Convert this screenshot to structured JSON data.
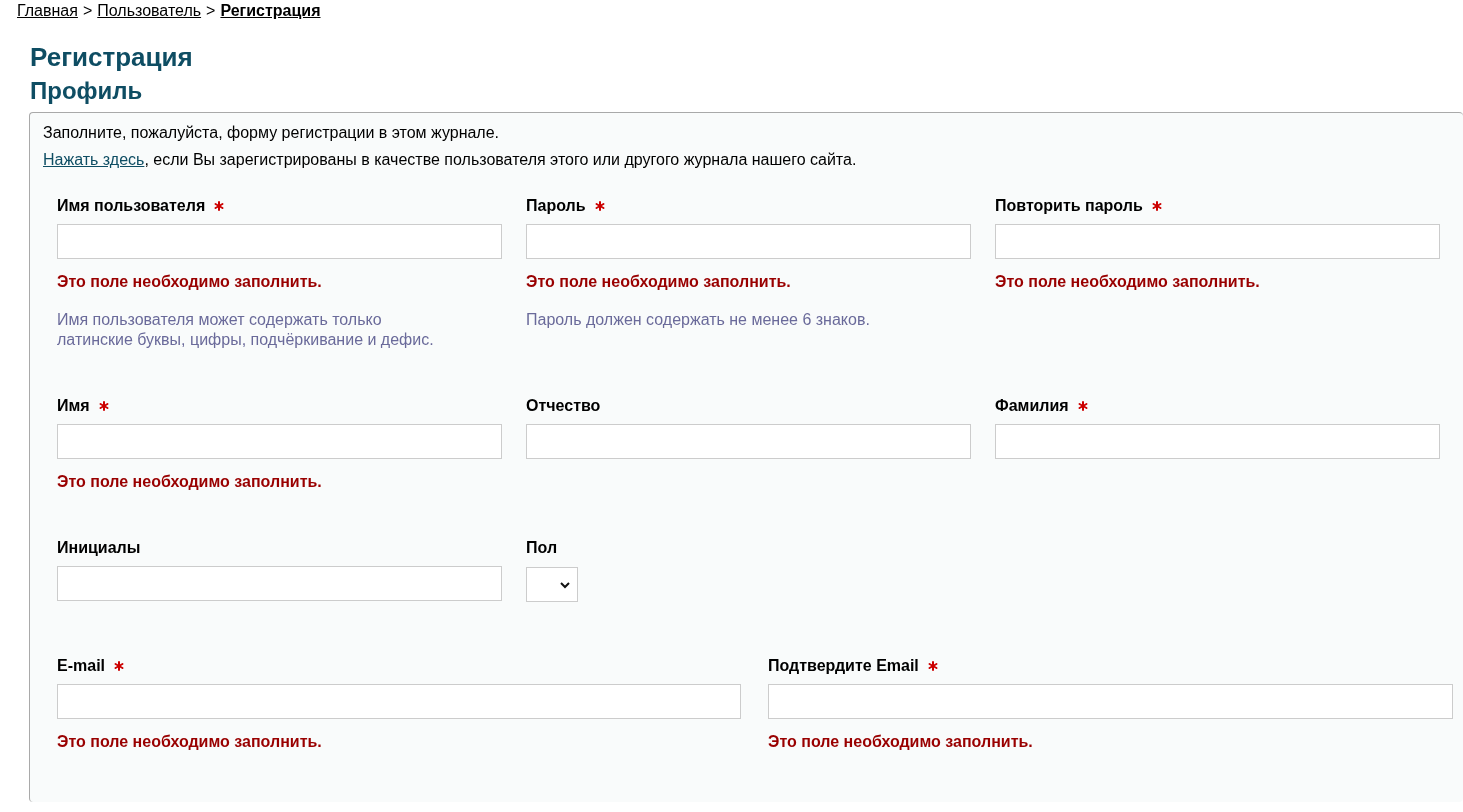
{
  "breadcrumb": [
    {
      "label": "Главная",
      "current": false
    },
    {
      "label": "Пользователь",
      "current": false
    },
    {
      "label": "Регистрация",
      "current": true
    }
  ],
  "breadcrumb_separator": ">",
  "title": "Регистрация",
  "subtitle": "Профиль",
  "intro": "Заполните, пожалуйста, форму регистрации в этом журнале.",
  "login_link": "Нажать здесь",
  "login_text": ", если Вы зарегистрированы в качестве пользователя этого или другого журнала нашего сайта.",
  "rows": [
    {
      "fields": [
        {
          "label": "Имя пользователя",
          "required": true,
          "kind": "text",
          "error": "Это поле необходимо заполнить.",
          "hint": "Имя пользователя может содержать только латинские буквы, цифры, подчёркивание и дефис."
        },
        {
          "label": "Пароль",
          "required": true,
          "kind": "text",
          "error": "Это поле необходимо заполнить.",
          "hint": "Пароль должен содержать не менее 6 знаков."
        },
        {
          "label": "Повторить пароль",
          "required": true,
          "kind": "text",
          "error": "Это поле необходимо заполнить."
        }
      ]
    },
    {
      "fields": [
        {
          "label": "Имя",
          "required": true,
          "kind": "text",
          "error": "Это поле необходимо заполнить."
        },
        {
          "label": "Отчество",
          "required": false,
          "kind": "text"
        },
        {
          "label": "Фамилия",
          "required": true,
          "kind": "text"
        }
      ]
    },
    {
      "fields": [
        {
          "label": "Инициалы",
          "required": false,
          "kind": "text"
        },
        {
          "label": "Пол",
          "required": false,
          "kind": "select"
        }
      ]
    },
    {
      "fields": [
        {
          "label": "E-mail",
          "required": true,
          "kind": "text",
          "error": "Это поле необходимо заполнить."
        },
        {
          "label": "Подтвердите Email",
          "required": true,
          "kind": "text",
          "error": "Это поле необходимо заполнить."
        }
      ]
    }
  ]
}
